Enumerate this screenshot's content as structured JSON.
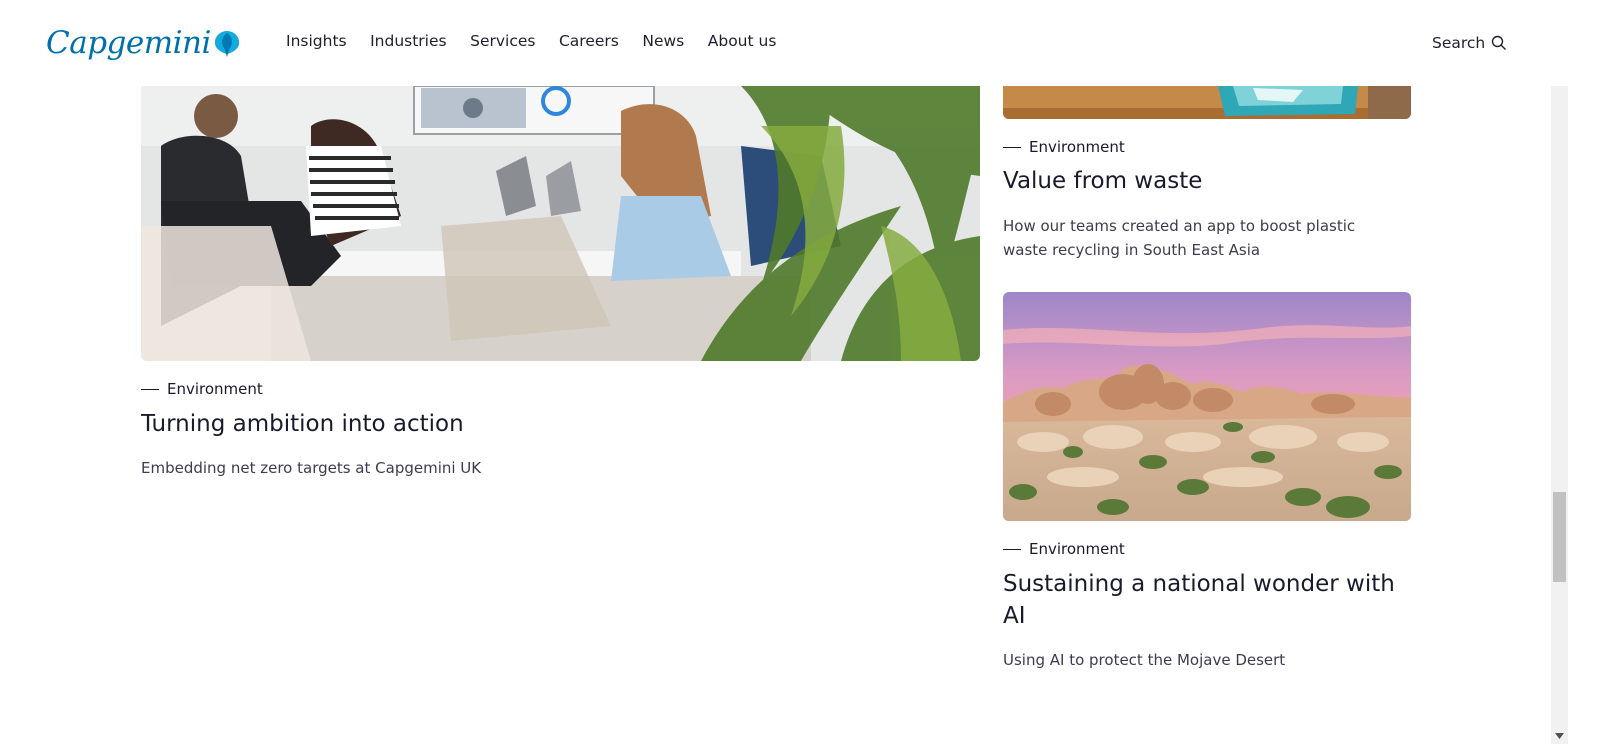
{
  "brand": {
    "name": "Capgemini"
  },
  "nav": {
    "items": [
      {
        "label": "Insights"
      },
      {
        "label": "Industries"
      },
      {
        "label": "Services"
      },
      {
        "label": "Careers"
      },
      {
        "label": "News"
      },
      {
        "label": "About us"
      }
    ],
    "search_label": "Search"
  },
  "cards": {
    "left": {
      "tag": "Environment",
      "title": "Turning ambition into action",
      "desc": "Embedding net zero targets at Capgemini UK"
    },
    "right_top": {
      "tag": "Environment",
      "title": "Value from waste",
      "desc_line1": "How our teams created an app to boost plastic",
      "desc_line2": "waste recycling in South East Asia"
    },
    "right_bottom": {
      "tag": "Environment",
      "title_line1": "Sustaining a national wonder with",
      "title_line2": "AI",
      "desc": "Using AI to protect the Mojave Desert"
    }
  },
  "colors": {
    "brand": "#0070ad",
    "text": "#1a1a2e"
  }
}
